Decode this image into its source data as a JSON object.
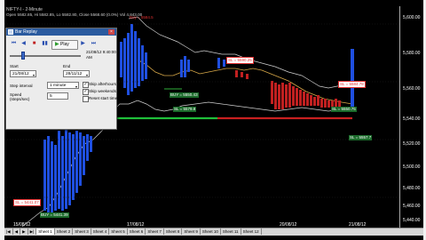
{
  "chart": {
    "title": "NIFTY-I - 2-Minute",
    "ohlc": "Open 5582.85, Hi 5582.85, Lo 5582.80, Close 5568.60 (0.0%) Vol 4,843.00",
    "price_labels": [
      "5,600.00",
      "5,580.00",
      "5,560.00",
      "5,540.00",
      "5,520.00",
      "5,500.00",
      "5,480.00",
      "5,460.00",
      "5,440.00"
    ],
    "date_labels": [
      "15/08/12",
      "17/08/12",
      "20/08/12",
      "21/08/12"
    ],
    "annotations": {
      "top_label": "Buy = 5584.5",
      "red1": "SL = 5590.25",
      "red2": "SL = 5584.78",
      "green1": "BUY = 5550.43",
      "green2": "SL = 5579.8",
      "green3": "SL = 5550.75",
      "sl_right": "SL = 5557.7",
      "sl_left": "SL = 5441.07",
      "buy_left": "BUY = 5441.39"
    }
  },
  "sheet_tabs": {
    "nav": [
      "|◀",
      "◀",
      "▶",
      "▶|"
    ],
    "items": [
      "Sheet 1",
      "Sheet 2",
      "Sheet 3",
      "Sheet 4",
      "Sheet 5",
      "Sheet 6",
      "Sheet 7",
      "Sheet 8",
      "Sheet 9",
      "Sheet 10",
      "Sheet 11",
      "Sheet 12"
    ]
  },
  "replay": {
    "title": "Bar Replay",
    "play_label": "Play",
    "progress": 0.17,
    "current_time": "21/08/12 9:40:00 AM",
    "start_label": "Start",
    "end_label": "End",
    "start_value": "21/08/12",
    "end_value": "28/11/12",
    "step_label": "Step interval",
    "step_value": "1 minute",
    "speed_label": "Speed (steps/sec)",
    "speed_value": "5",
    "opts": [
      "Skip afterhours",
      "Skip weekends",
      "Reset start time"
    ]
  }
}
